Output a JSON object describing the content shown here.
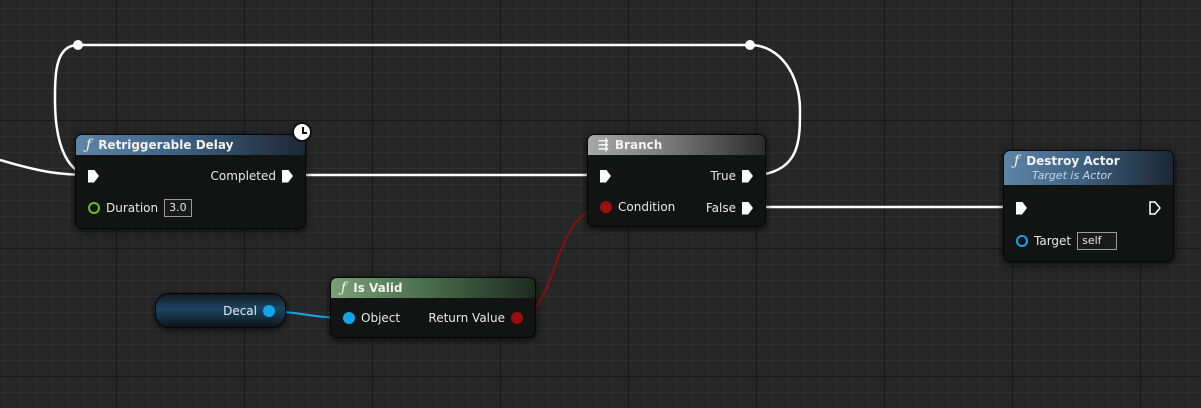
{
  "nodes": {
    "retriggerable_delay": {
      "title": "Retriggerable Delay",
      "completed_label": "Completed",
      "duration_label": "Duration",
      "duration_value": "3.0"
    },
    "branch": {
      "title": "Branch",
      "condition_label": "Condition",
      "true_label": "True",
      "false_label": "False"
    },
    "destroy_actor": {
      "title": "Destroy Actor",
      "subtitle": "Target is Actor",
      "target_label": "Target",
      "target_value": "self"
    },
    "is_valid": {
      "title": "Is Valid",
      "object_label": "Object",
      "return_label": "Return Value"
    },
    "decal_var": {
      "label": "Decal"
    }
  },
  "icons": {
    "function": "ƒ",
    "branch": "branch-icon",
    "clock": "clock-icon"
  },
  "colors": {
    "exec_wire": "#ffffff",
    "object_wire": "#16a4e8",
    "bool_wire": "#8a1010",
    "float_pin": "#56c62b",
    "function_header": "#3f6181",
    "branch_header": "#7a7a7a",
    "pure_header": "#4c6f4e"
  }
}
